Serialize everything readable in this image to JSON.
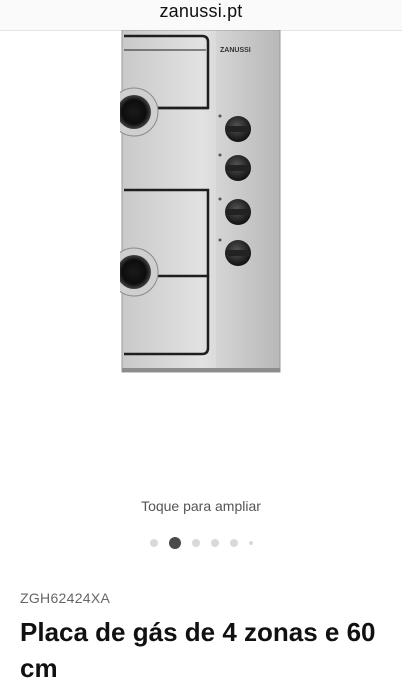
{
  "browser": {
    "url_label": "zanussi.pt"
  },
  "gallery": {
    "image_alt_icon": "gas-hob-photo",
    "zoom_hint": "Toque para ampliar",
    "dots_total": 6,
    "active_index": 1
  },
  "product": {
    "model_code": "ZGH62424XA",
    "title": "Placa de gás de 4 zonas e 60 cm"
  },
  "colors": {
    "text_primary": "#111111",
    "text_secondary": "#555555",
    "dot_inactive": "#d9d9d9",
    "dot_active": "#4a4a4a"
  }
}
